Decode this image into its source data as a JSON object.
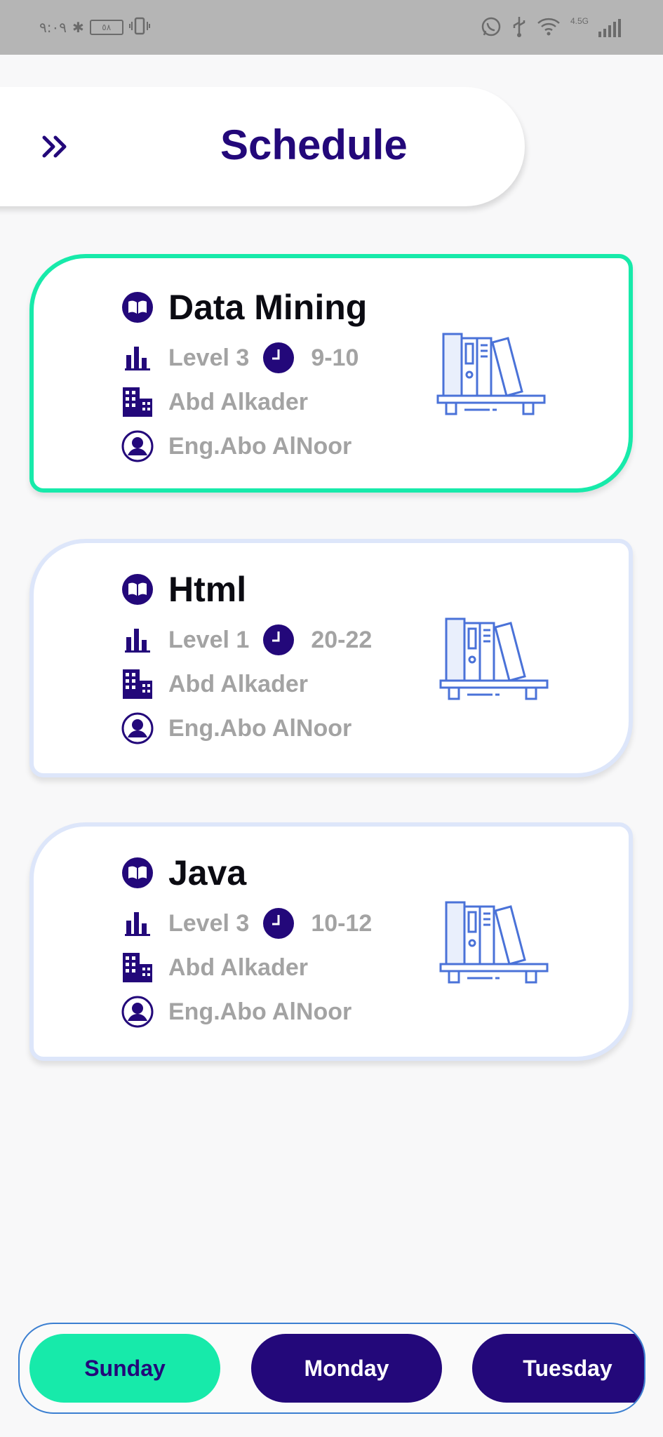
{
  "status_bar": {
    "time": "٩:٠٩",
    "battery": "٥٨",
    "network": "4.5G"
  },
  "header": {
    "menu_icon": "double-chevron-right-icon",
    "title": "Schedule"
  },
  "colors": {
    "primary": "#23087a",
    "accent": "#17eaaa",
    "card_border": "#dde6fa",
    "muted_text": "#a3a3a3",
    "illustration": "#4a72d8"
  },
  "courses": [
    {
      "name": "Data Mining",
      "level": "Level 3",
      "time": "9-10",
      "building": "Abd Alkader",
      "instructor": "Eng.Abo AlNoor",
      "selected": true
    },
    {
      "name": "Html",
      "level": "Level 1",
      "time": "20-22",
      "building": "Abd Alkader",
      "instructor": "Eng.Abo AlNoor",
      "selected": false
    },
    {
      "name": "Java",
      "level": "Level 3",
      "time": "10-12",
      "building": "Abd Alkader",
      "instructor": "Eng.Abo AlNoor",
      "selected": false
    }
  ],
  "days": {
    "selected": "Sunday",
    "items": [
      "Sunday",
      "Monday",
      "Tuesday"
    ]
  }
}
